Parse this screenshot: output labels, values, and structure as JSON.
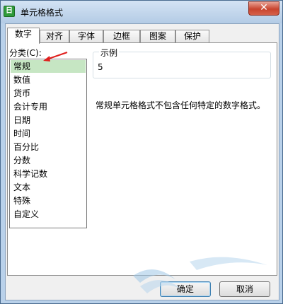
{
  "window": {
    "title": "单元格格式",
    "icon_letter": "日",
    "close_glyph": "✕"
  },
  "tabs": [
    {
      "label": "数字",
      "active": true
    },
    {
      "label": "对齐"
    },
    {
      "label": "字体"
    },
    {
      "label": "边框"
    },
    {
      "label": "图案"
    },
    {
      "label": "保护"
    }
  ],
  "category": {
    "label": "分类(C):",
    "items": [
      "常规",
      "数值",
      "货币",
      "会计专用",
      "日期",
      "时间",
      "百分比",
      "分数",
      "科学记数",
      "文本",
      "特殊",
      "自定义"
    ],
    "selected_index": 0
  },
  "example": {
    "legend": "示例",
    "value": "5"
  },
  "description": "常规单元格格式不包含任何特定的数字格式。",
  "buttons": {
    "ok": "确定",
    "cancel": "取消"
  },
  "colors": {
    "selected_bg": "#c6e6c3",
    "arrow": "#e0201e"
  }
}
